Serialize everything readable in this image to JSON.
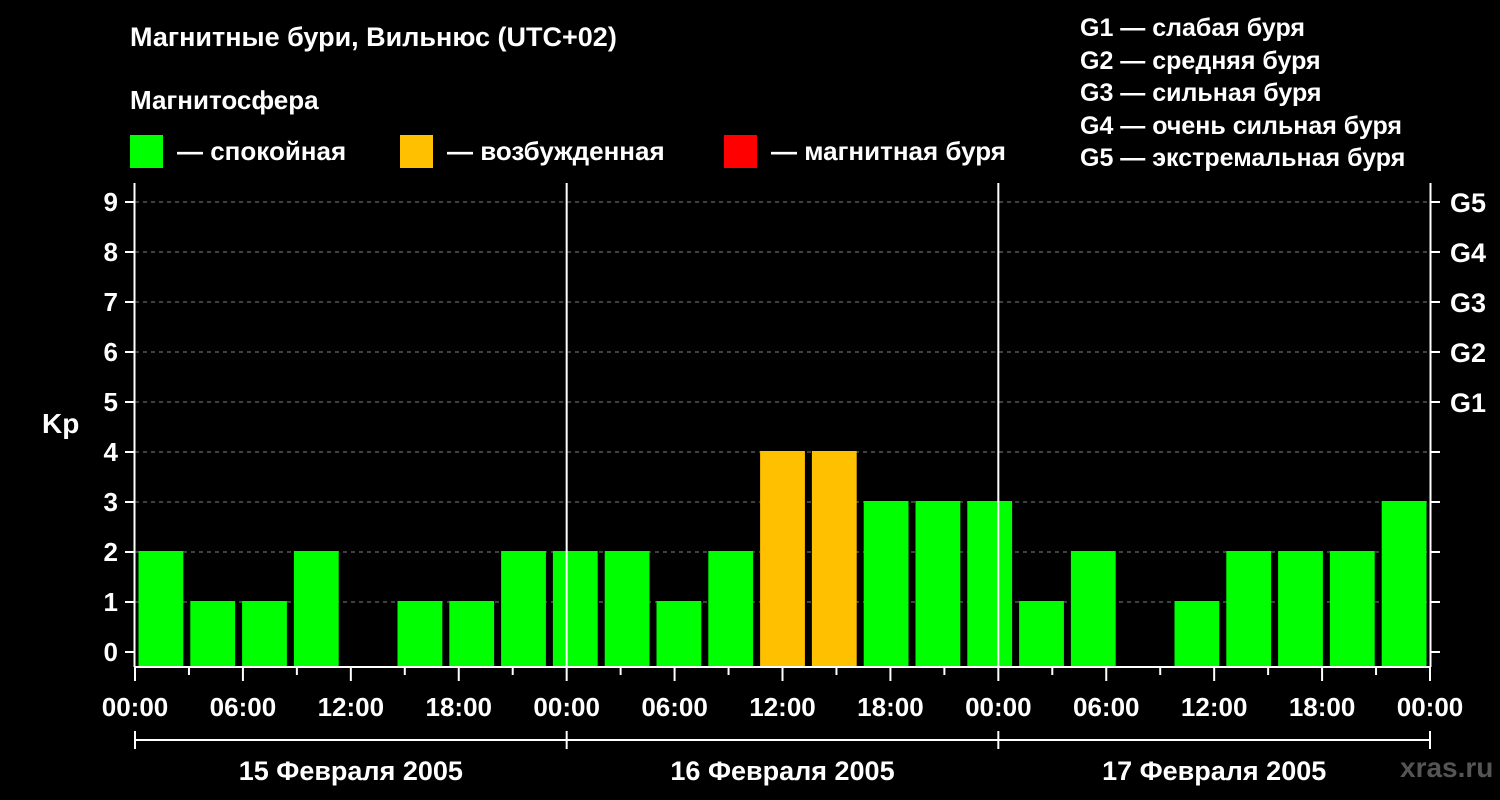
{
  "title": "Магнитные бури, Вильнюс (UTC+02)",
  "subtitle": "Магнитосфера",
  "legend": [
    {
      "label": "— спокойная",
      "color": "#00ff00"
    },
    {
      "label": "— возбужденная",
      "color": "#ffc000"
    },
    {
      "label": "— магнитная буря",
      "color": "#ff0000"
    }
  ],
  "g_legend": [
    "G1 — слабая буря",
    "G2 — средняя буря",
    "G3 — сильная буря",
    "G4 — очень сильная буря",
    "G5 — экстремальная буря"
  ],
  "watermark": "xras.ru",
  "chart_data": {
    "type": "bar",
    "ylabel": "Kp",
    "ylim": [
      0,
      9
    ],
    "y_ticks": [
      "0",
      "1",
      "2",
      "3",
      "4",
      "5",
      "6",
      "7",
      "8",
      "9"
    ],
    "right_ticks": [
      {
        "label": "G1",
        "y": 5
      },
      {
        "label": "G2",
        "y": 6
      },
      {
        "label": "G3",
        "y": 7
      },
      {
        "label": "G4",
        "y": 8
      },
      {
        "label": "G5",
        "y": 9
      }
    ],
    "x_tick_labels": [
      "00:00",
      "06:00",
      "12:00",
      "18:00",
      "00:00",
      "06:00",
      "12:00",
      "18:00",
      "00:00",
      "06:00",
      "12:00",
      "18:00",
      "00:00"
    ],
    "days": [
      "15 Февраля 2005",
      "16 Февраля 2005",
      "17 Февраля 2005"
    ],
    "interval_hours": 3,
    "grid": "dashed horizontal",
    "colors": {
      "quiet": "#00ff00",
      "active": "#ffc000",
      "storm": "#ff0000"
    },
    "values": [
      2,
      1,
      1,
      2,
      0,
      1,
      1,
      2,
      2,
      2,
      1,
      2,
      4,
      4,
      3,
      3,
      3,
      1,
      2,
      0,
      1,
      2,
      2,
      2,
      3
    ]
  }
}
